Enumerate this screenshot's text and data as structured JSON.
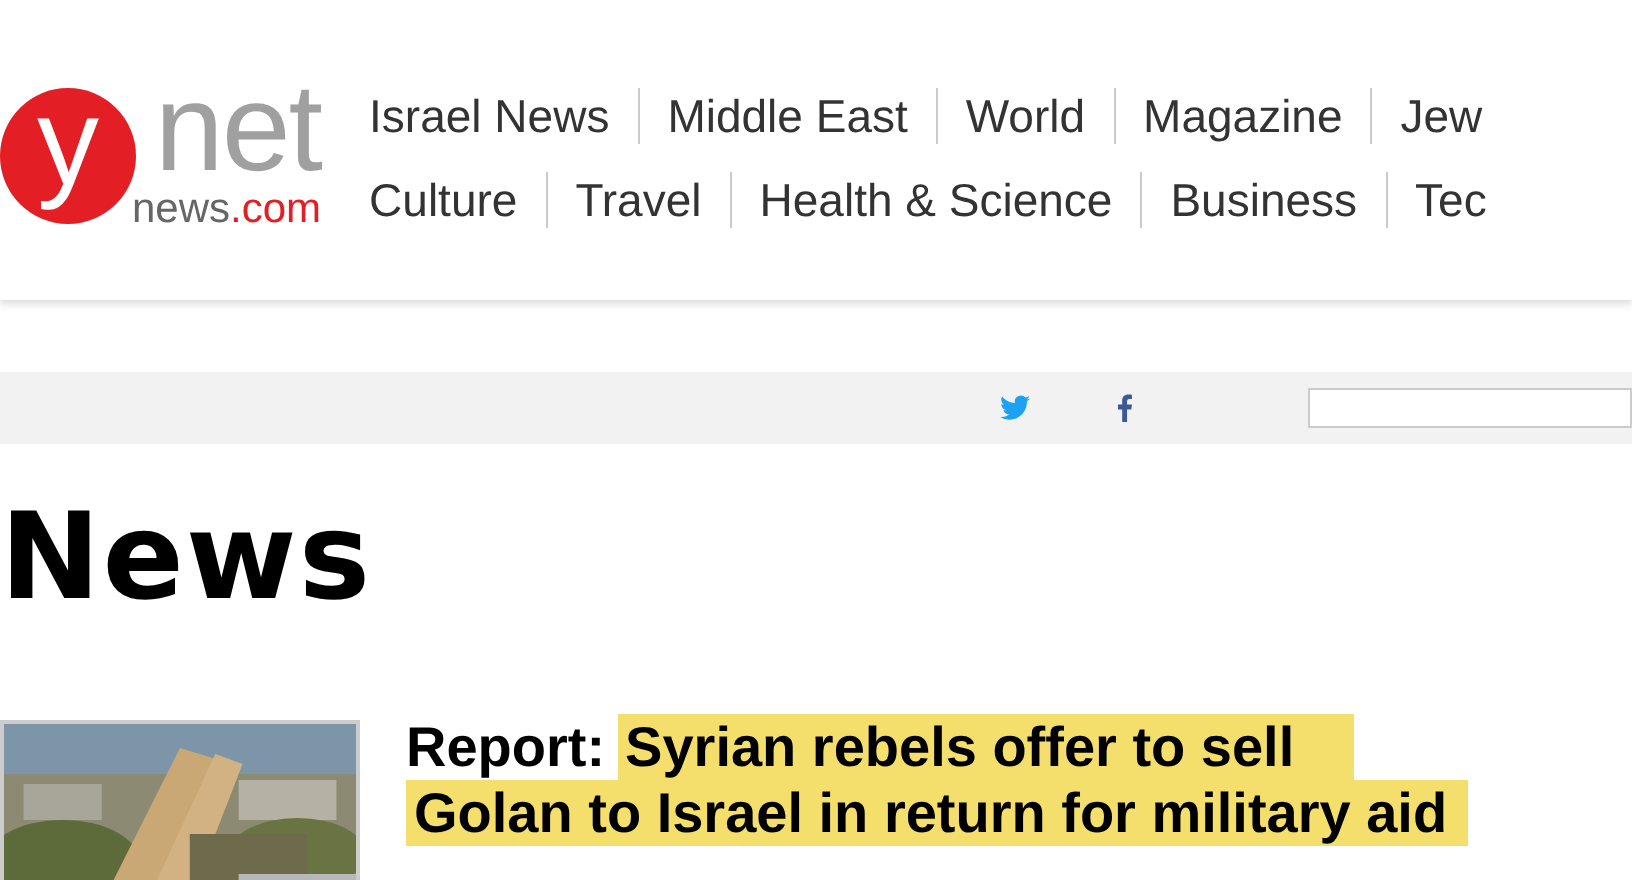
{
  "logo": {
    "letter": "y",
    "word": "net",
    "domain": "news",
    "tld": ".com"
  },
  "nav": [
    [
      "Israel News",
      "Middle East",
      "World",
      "Magazine",
      "Jew"
    ],
    [
      "Culture",
      "Travel",
      "Health & Science",
      "Business",
      "Tec"
    ]
  ],
  "section_title": "News",
  "article": {
    "prefix": "Report:",
    "headline_lines": [
      "Syrian rebels offer to sell",
      "Golan to Israel in return for military aid"
    ]
  }
}
